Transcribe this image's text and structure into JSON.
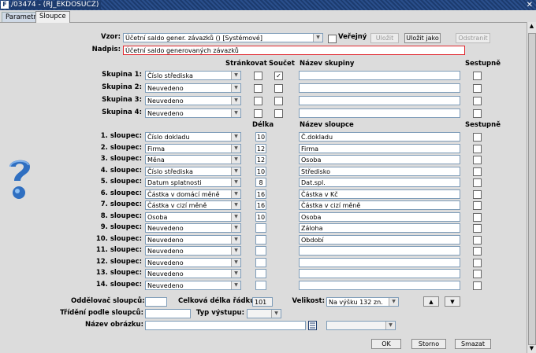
{
  "window": {
    "title": "/03474 - (RJ_EKDOSUCZ)",
    "close": "✕"
  },
  "tabs": [
    {
      "label": "Parametry"
    },
    {
      "label": "Sloupce"
    }
  ],
  "vzor": {
    "label": "Vzor:",
    "value": "Účetní saldo gener. závazků  ()  [Systémové]",
    "verejny_label": "Veřejný",
    "ulozit": "Uložit",
    "ulozit_jako": "Uložit jako",
    "odstranit": "Odstranit"
  },
  "nadpis": {
    "label": "Nadpis:",
    "value": "Účetní saldo generovaných závazků"
  },
  "headers": {
    "strankovat": "Stránkovat",
    "soucet": "Součet",
    "nazev_skupiny": "Název skupiny",
    "sestupne": "Sestupně",
    "delka": "Délka",
    "nazev_sloupce": "Název sloupce",
    "sestupne2": "Sestupně"
  },
  "groups": [
    {
      "label": "Skupina 1:",
      "value": "Číslo střediska",
      "strankovat": false,
      "soucet": true,
      "name": "",
      "desc": false
    },
    {
      "label": "Skupina 2:",
      "value": "Neuvedeno",
      "strankovat": false,
      "soucet": false,
      "name": "",
      "desc": false
    },
    {
      "label": "Skupina 3:",
      "value": "Neuvedeno",
      "strankovat": false,
      "soucet": false,
      "name": "",
      "desc": false
    },
    {
      "label": "Skupina 4:",
      "value": "Neuvedeno",
      "strankovat": false,
      "soucet": false,
      "name": "",
      "desc": false
    }
  ],
  "columns": [
    {
      "label": "1. sloupec:",
      "value": "Číslo dokladu",
      "len": "10",
      "name": "Č.dokladu"
    },
    {
      "label": "2. sloupec:",
      "value": "Firma",
      "len": "12",
      "name": "Firma"
    },
    {
      "label": "3. sloupec:",
      "value": "Měna",
      "len": "12",
      "name": "Osoba"
    },
    {
      "label": "4. sloupec:",
      "value": "Číslo střediska",
      "len": "10",
      "name": "Středisko"
    },
    {
      "label": "5. sloupec:",
      "value": "Datum splatnosti",
      "len": "8",
      "name": "Dat.spl."
    },
    {
      "label": "6. sloupec:",
      "value": "Částka v domácí měně",
      "len": "16",
      "name": "Částka v Kč"
    },
    {
      "label": "7. sloupec:",
      "value": "Částka v cizí měně",
      "len": "16",
      "name": "Částka v cizí měně"
    },
    {
      "label": "8. sloupec:",
      "value": "Osoba",
      "len": "10",
      "name": "Osoba"
    },
    {
      "label": "9. sloupec:",
      "value": "Neuvedeno",
      "len": "",
      "name": "Záloha"
    },
    {
      "label": "10. sloupec:",
      "value": "Neuvedeno",
      "len": "",
      "name": "Období"
    },
    {
      "label": "11. sloupec:",
      "value": "Neuvedeno",
      "len": "",
      "name": ""
    },
    {
      "label": "12. sloupec:",
      "value": "Neuvedeno",
      "len": "",
      "name": ""
    },
    {
      "label": "13. sloupec:",
      "value": "Neuvedeno",
      "len": "",
      "name": ""
    },
    {
      "label": "14. sloupec:",
      "value": "Neuvedeno",
      "len": "",
      "name": ""
    }
  ],
  "bottom": {
    "oddelovac_label": "Oddělovač sloupců:",
    "oddelovac_value": "",
    "celkova_label": "Celková délka řádku:",
    "celkova_value": "101",
    "velikost_label": "Velikost:",
    "velikost_value": "Na výšku 132 zn.",
    "trideni_label": "Třídění podle sloupců:",
    "trideni_value": "",
    "typ_label": "Typ výstupu:",
    "typ_value": "",
    "obrazek_label": "Název obrázku:",
    "obrazek_value": "",
    "up": "▲",
    "down": "▼"
  },
  "actions": {
    "ok": "OK",
    "storno": "Storno",
    "smazat": "Smazat"
  },
  "icons": {
    "help": "help-icon",
    "list": "list-icon"
  }
}
